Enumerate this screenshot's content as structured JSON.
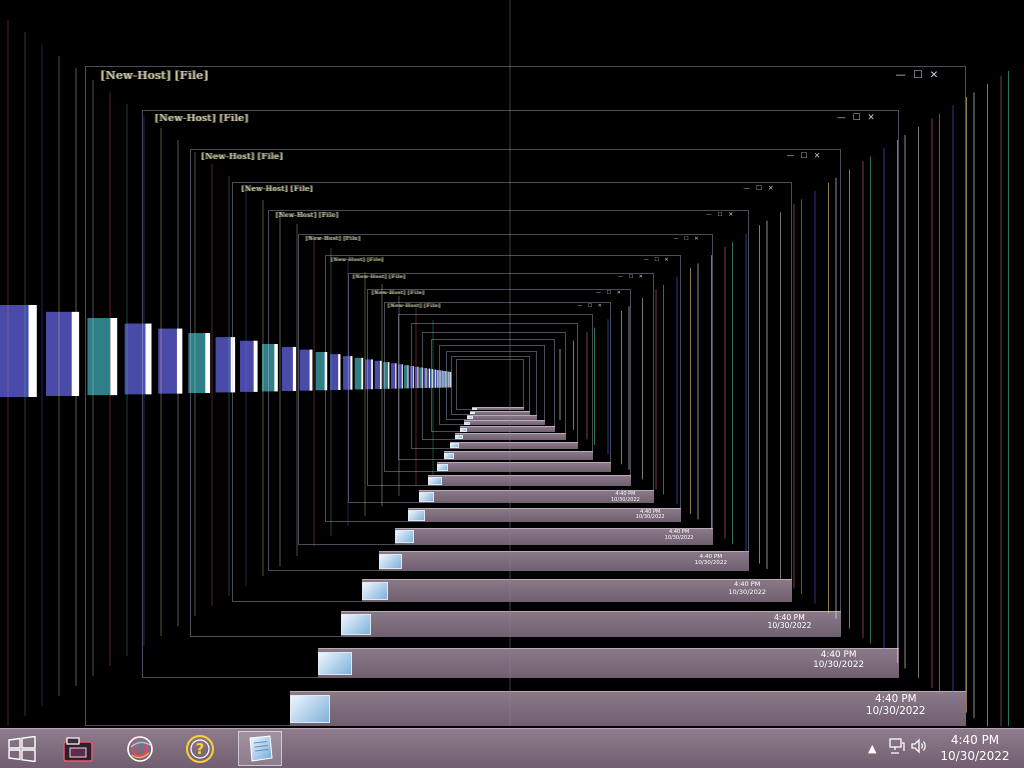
{
  "window": {
    "title": "[New-Host] [File]",
    "controls": "—   ☐   ✕"
  },
  "taskbar": {
    "start_icon": "windows-logo-icon",
    "pinned": [
      {
        "name": "file-explorer-icon"
      },
      {
        "name": "internet-icon"
      },
      {
        "name": "help-icon"
      },
      {
        "name": "notepad-icon",
        "active": true
      }
    ],
    "tray": {
      "show_hidden_icon": "caret-up-icon",
      "network_icon": "network-icon",
      "volume_icon": "speaker-icon",
      "time": "4:40 PM",
      "date": "10/30/2022"
    }
  },
  "colors": {
    "taskbar_top": "#8e7d8c",
    "taskbar_bottom": "#715e70",
    "background": "#000000",
    "stripe_blue": "#4a4aa8",
    "stripe_teal": "#2f7f86"
  }
}
